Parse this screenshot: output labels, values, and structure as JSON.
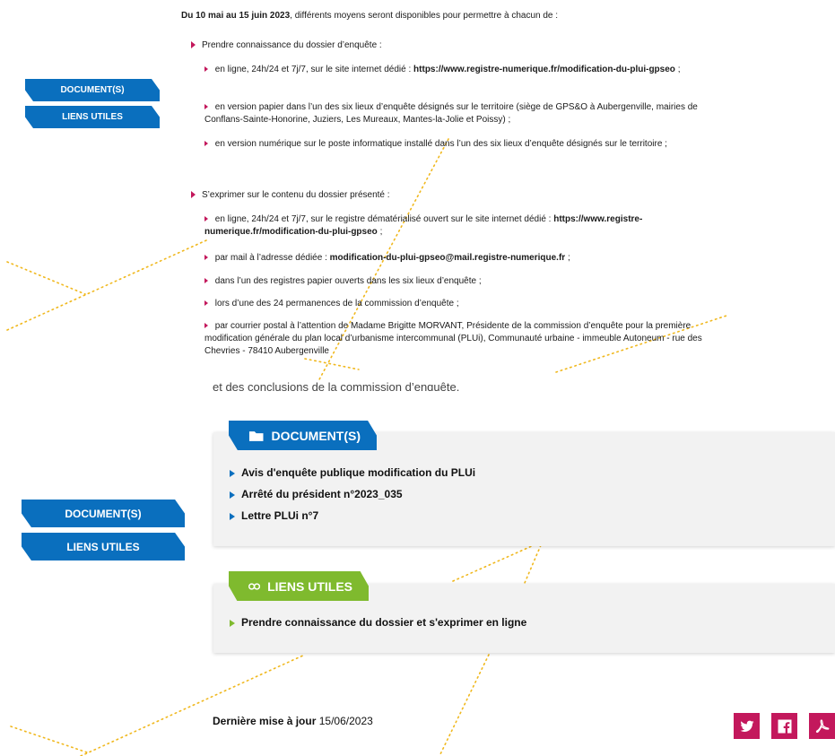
{
  "sidebar_top": {
    "document_label": "DOCUMENT(S)",
    "liens_label": "LIENS UTILES"
  },
  "sidebar_bottom": {
    "document_label": "DOCUMENT(S)",
    "liens_label": "LIENS UTILES"
  },
  "intro": {
    "lead_bold": "Du 10 mai au 15 juin 2023",
    "lead_rest": ", différents moyens seront disponibles pour permettre à chacun de :",
    "section1_title": "Prendre connaissance du dossier d’enquête :",
    "s1_item1_pre": "en ligne, 24h/24 et 7j/7, sur le site internet dédié :",
    "s1_item1_link": "https://www.registre-numerique.fr/modification-du-plui-gpseo",
    "s1_item1_post": ";",
    "s1_item2": "en version papier dans l’un des six lieux d’enquête désignés sur le territoire (siège de GPS&O à Aubergenville, mairies de Conflans-Sainte-Honorine, Juziers, Les Mureaux, Mantes-la-Jolie et Poissy) ;",
    "s1_item3": "en version numérique sur le poste informatique installé dans l’un des six lieux d’enquête désignés sur le territoire ;",
    "section2_title": "S’exprimer sur le contenu du dossier présenté :",
    "s2_item1_pre": "en ligne, 24h/24 et 7j/7, sur le registre dématérialisé ouvert sur le site internet dédié :",
    "s2_item1_link": "https://www.registre-numerique.fr/modification-du-plui-gpseo",
    "s2_item1_post": ";",
    "s2_item2_pre": "par mail à l’adresse dédiée :",
    "s2_item2_email": "modification-du-plui-gpseo@mail.registre-numerique.fr",
    "s2_item2_post": ";",
    "s2_item3": "dans l’un des registres papier ouverts dans les six lieux d’enquête ;",
    "s2_item4": "lors d’une des 24 permanences de la commission d’enquête ;",
    "s2_item5": "par courrier postal à l’attention de Madame Brigitte MORVANT, Présidente de la commission d’enquête pour la première modification générale du plan local d’urbanisme intercommunal (PLUi), Communauté urbaine - immeuble Autoneum - rue des Chevries - 78410 Aubergenville"
  },
  "cut_text": "et des conclusions de la commission d’enquête.",
  "documents": {
    "tab_label": "DOCUMENT(S)",
    "items": [
      "Avis d'enquête publique modification du PLUi",
      "Arrêté du président n°2023_035",
      "Lettre PLUi n°7"
    ]
  },
  "liens": {
    "tab_label": "LIENS UTILES",
    "items": [
      "Prendre connaissance du dossier et s'exprimer en ligne"
    ]
  },
  "footer": {
    "updated_label": "Dernière mise à jour",
    "updated_date": "15/06/2023"
  },
  "share_icons": [
    "twitter-icon",
    "facebook-icon",
    "pdf-icon"
  ],
  "colors": {
    "blue": "#0a6fbe",
    "green": "#7fba2e",
    "magenta": "#c3185c",
    "dots": "#f0b81e"
  }
}
